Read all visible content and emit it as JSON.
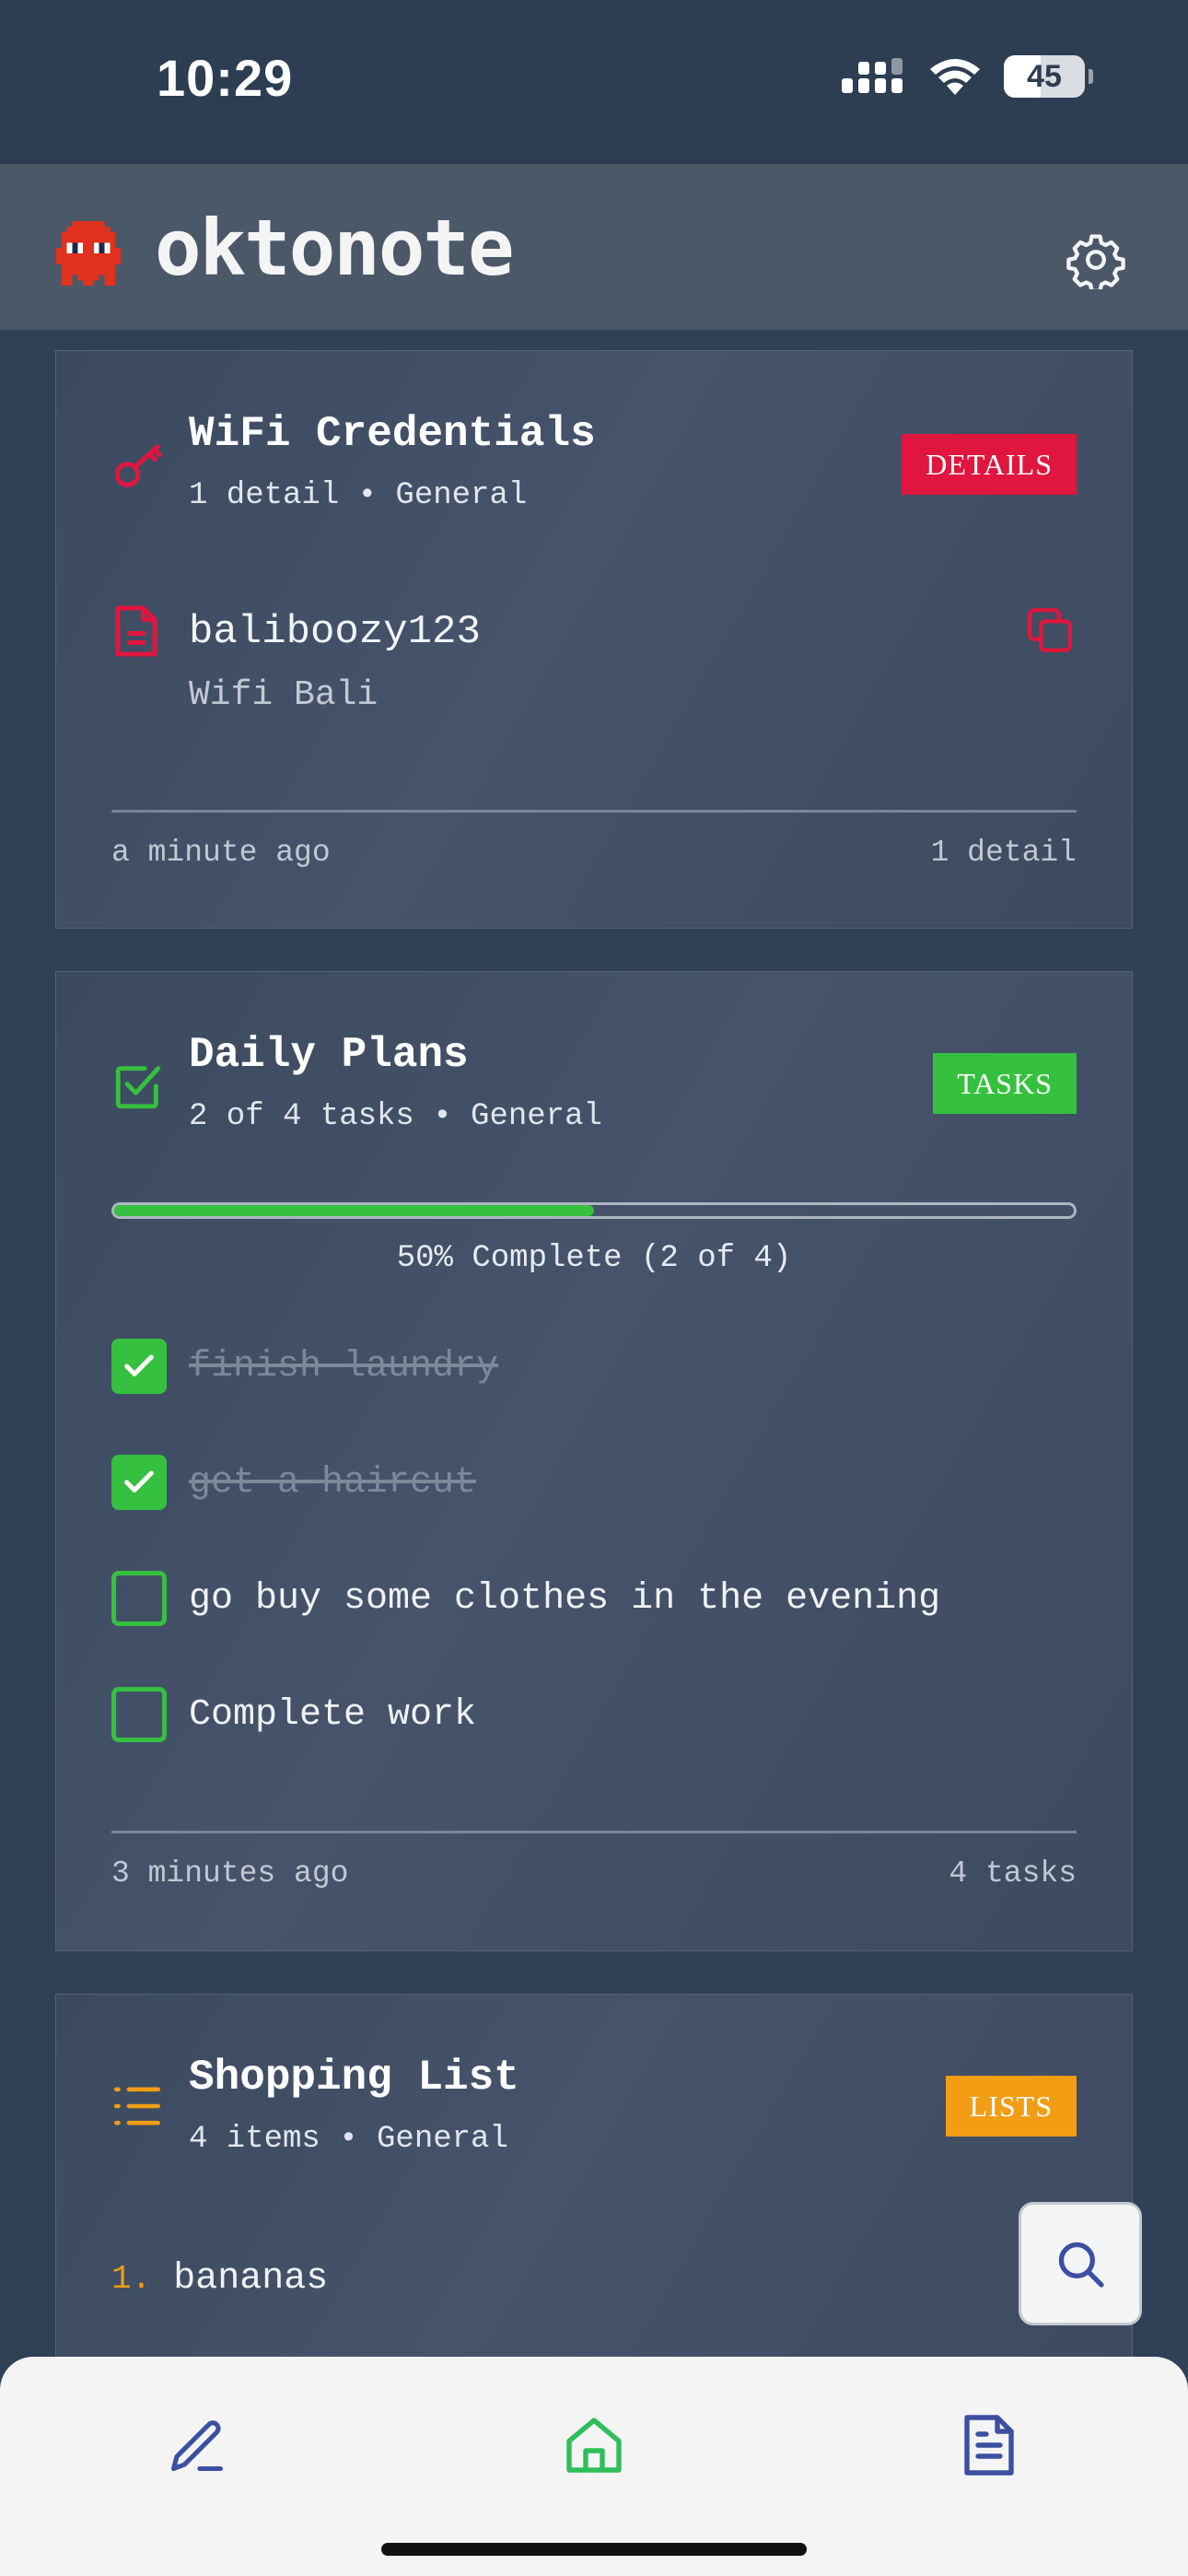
{
  "status_bar": {
    "time": "10:29",
    "battery": "45"
  },
  "app": {
    "title": "oktonote"
  },
  "cards": [
    {
      "title": "WiFi Credentials",
      "subtitle": "1 detail • General",
      "badge": "DETAILS",
      "badge_color": "#e0163f",
      "detail_value": "baliboozy123",
      "detail_label": "Wifi Bali",
      "footer_left": "a minute ago",
      "footer_right": "1 detail"
    },
    {
      "title": "Daily Plans",
      "subtitle": "2 of 4 tasks • General",
      "badge": "TASKS",
      "badge_color": "#36c03f",
      "progress": 0.5,
      "progress_label": "50% Complete (2 of 4)",
      "tasks": [
        {
          "text": "finish laundry",
          "done": true
        },
        {
          "text": "get a haircut",
          "done": true
        },
        {
          "text": "go buy some clothes in the evening",
          "done": false
        },
        {
          "text": "Complete work",
          "done": false
        }
      ],
      "footer_left": "3 minutes ago",
      "footer_right": "4 tasks"
    },
    {
      "title": "Shopping List",
      "subtitle": "4 items • General",
      "badge": "LISTS",
      "badge_color": "#f29d13",
      "items": [
        {
          "num": "1.",
          "text": "bananas"
        }
      ]
    }
  ],
  "icons": {
    "header_logo": "ghost-logo-icon",
    "settings": "gear-icon",
    "wifi_card": "key-icon",
    "detail": "document-icon",
    "copy": "copy-icon",
    "tasks_card": "checkbox-icon",
    "lists_card": "list-icon",
    "fab": "search-icon",
    "nav_left": "pencil-icon",
    "nav_center": "home-icon",
    "nav_right": "notes-icon"
  }
}
